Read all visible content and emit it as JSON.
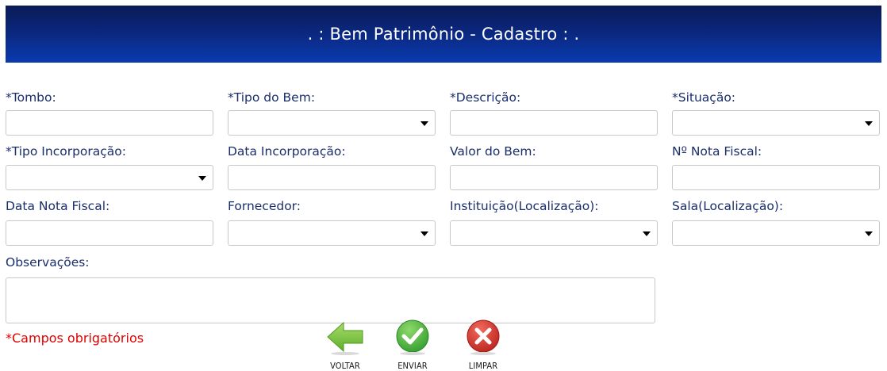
{
  "header": {
    "title": ". : Bem Patrimônio - Cadastro : ."
  },
  "fields": {
    "tombo": {
      "label": "*Tombo:",
      "value": ""
    },
    "tipo_bem": {
      "label": "*Tipo do Bem:",
      "value": ""
    },
    "descricao": {
      "label": "*Descrição:",
      "value": ""
    },
    "situacao": {
      "label": "*Situação:",
      "value": ""
    },
    "tipo_incorporacao": {
      "label": "*Tipo Incorporação:",
      "value": ""
    },
    "data_incorporacao": {
      "label": "Data Incorporação:",
      "value": ""
    },
    "valor_bem": {
      "label": "Valor do Bem:",
      "value": ""
    },
    "nota_fiscal": {
      "label": "Nº Nota Fiscal:",
      "value": ""
    },
    "data_nota_fiscal": {
      "label": "Data Nota Fiscal:",
      "value": ""
    },
    "fornecedor": {
      "label": "Fornecedor:",
      "value": ""
    },
    "instituicao": {
      "label": "Instituição(Localização):",
      "value": ""
    },
    "sala": {
      "label": "Sala(Localização):",
      "value": ""
    },
    "observacoes": {
      "label": "Observações:",
      "value": ""
    }
  },
  "required_note": "*Campos obrigatórios",
  "buttons": {
    "voltar": {
      "label": "VOLTAR",
      "icon": "arrow-left-icon",
      "color": "#7cc243"
    },
    "enviar": {
      "label": "ENVIAR",
      "icon": "check-icon",
      "color": "#3da83a"
    },
    "limpar": {
      "label": "LIMPAR",
      "icon": "close-icon",
      "color": "#d0322a"
    }
  },
  "colors": {
    "header_bg": "#0b2a86",
    "label_text": "#1a2e6c",
    "required_text": "#e00000"
  }
}
